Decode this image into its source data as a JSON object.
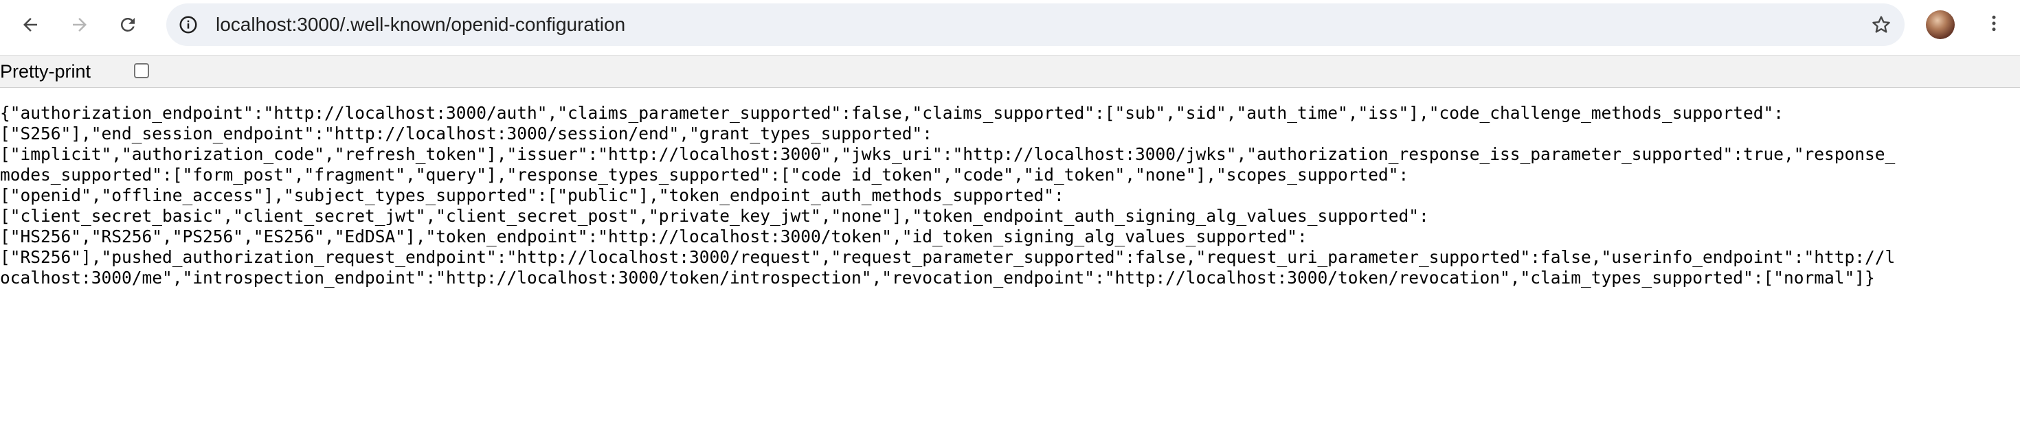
{
  "browser": {
    "url": "localhost:3000/.well-known/openid-configuration",
    "icons": {
      "back": "arrow-left-icon",
      "forward": "arrow-right-icon",
      "reload": "reload-icon",
      "site_info": "site-info-icon",
      "bookmark": "star-icon",
      "menu": "kebab-menu-icon"
    },
    "colors": {
      "omnibox_bg": "#eef1f6",
      "toolbar_bg": "#ffffff",
      "pretty_bar_bg": "#f2f2f2"
    }
  },
  "page": {
    "pretty_print_label": "Pretty-print",
    "pretty_print_checked": false,
    "json_text": "{\"authorization_endpoint\":\"http://localhost:3000/auth\",\"claims_parameter_supported\":false,\"claims_supported\":[\"sub\",\"sid\",\"auth_time\",\"iss\"],\"code_challenge_methods_supported\":\n[\"S256\"],\"end_session_endpoint\":\"http://localhost:3000/session/end\",\"grant_types_supported\":\n[\"implicit\",\"authorization_code\",\"refresh_token\"],\"issuer\":\"http://localhost:3000\",\"jwks_uri\":\"http://localhost:3000/jwks\",\"authorization_response_iss_parameter_supported\":true,\"response_\nmodes_supported\":[\"form_post\",\"fragment\",\"query\"],\"response_types_supported\":[\"code id_token\",\"code\",\"id_token\",\"none\"],\"scopes_supported\":\n[\"openid\",\"offline_access\"],\"subject_types_supported\":[\"public\"],\"token_endpoint_auth_methods_supported\":\n[\"client_secret_basic\",\"client_secret_jwt\",\"client_secret_post\",\"private_key_jwt\",\"none\"],\"token_endpoint_auth_signing_alg_values_supported\":\n[\"HS256\",\"RS256\",\"PS256\",\"ES256\",\"EdDSA\"],\"token_endpoint\":\"http://localhost:3000/token\",\"id_token_signing_alg_values_supported\":\n[\"RS256\"],\"pushed_authorization_request_endpoint\":\"http://localhost:3000/request\",\"request_parameter_supported\":false,\"request_uri_parameter_supported\":false,\"userinfo_endpoint\":\"http://l\nocalhost:3000/me\",\"introspection_endpoint\":\"http://localhost:3000/token/introspection\",\"revocation_endpoint\":\"http://localhost:3000/token/revocation\",\"claim_types_supported\":[\"normal\"]}"
  }
}
